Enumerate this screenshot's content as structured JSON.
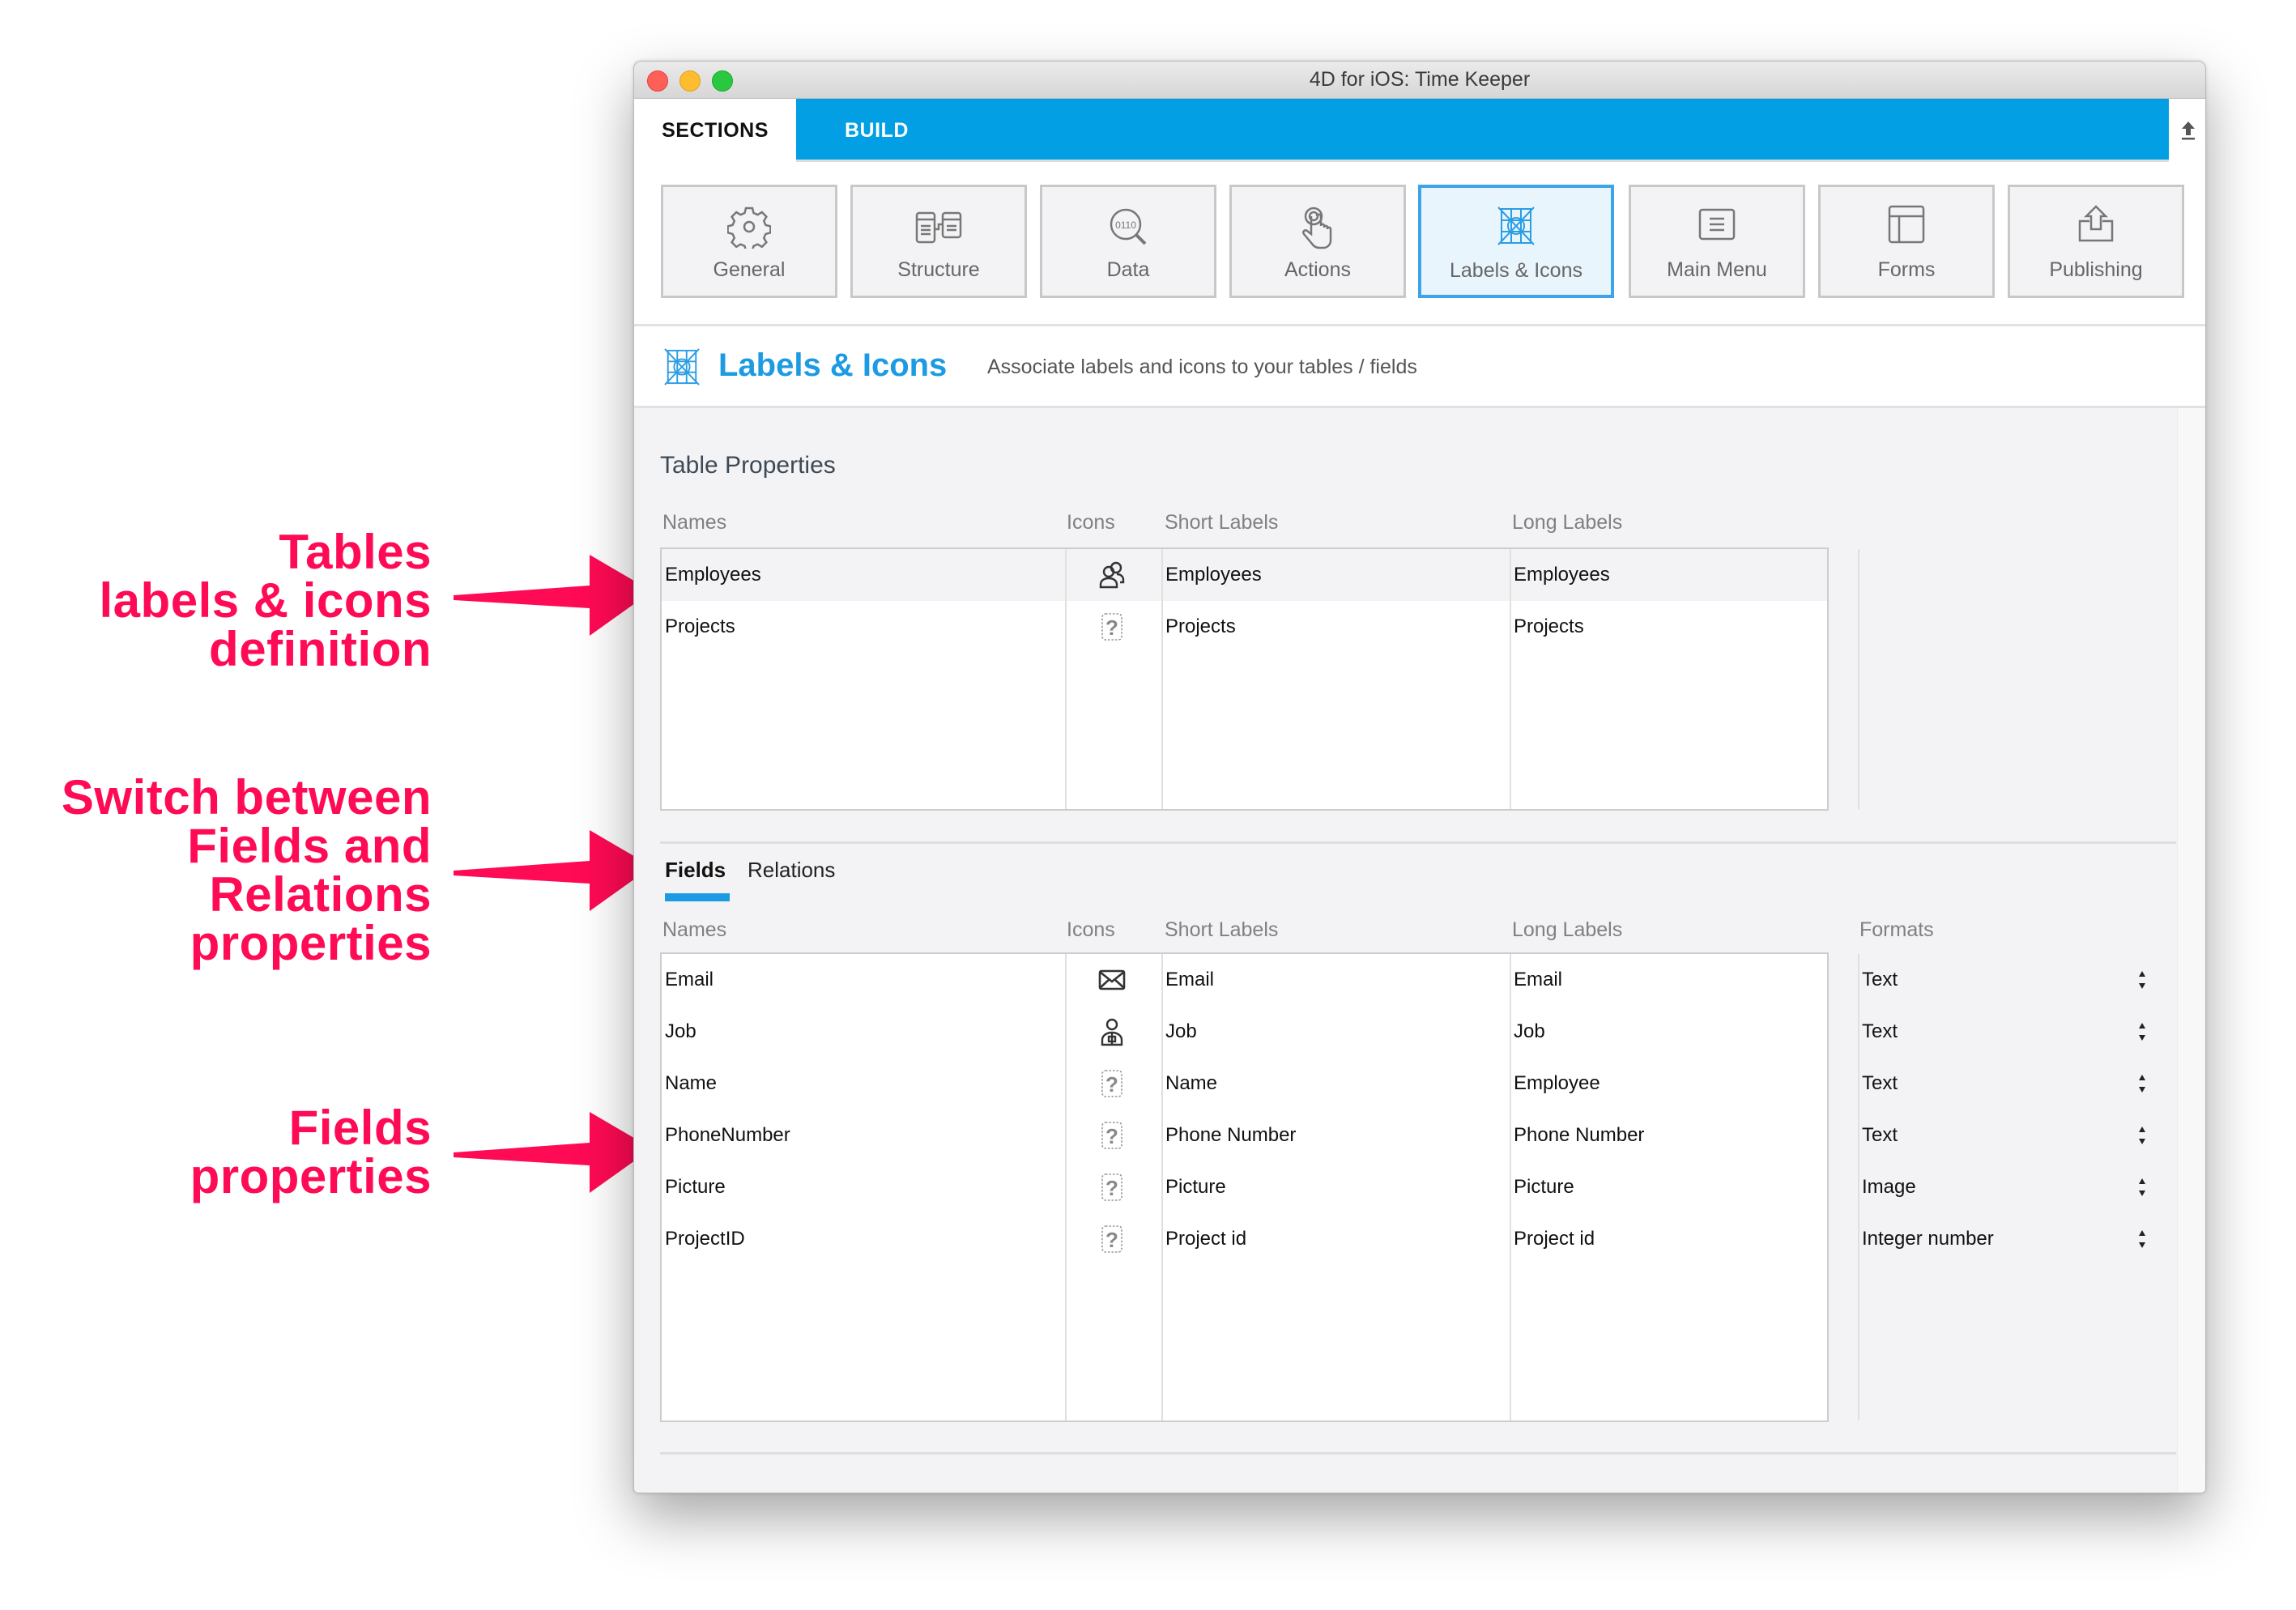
{
  "annotations": [
    {
      "lines": [
        "Tables",
        "labels & icons",
        "definition"
      ]
    },
    {
      "lines": [
        "Switch between",
        "Fields and",
        "Relations",
        "properties"
      ]
    },
    {
      "lines": [
        "Fields",
        "properties"
      ]
    }
  ],
  "window": {
    "title": "4D for iOS: Time Keeper"
  },
  "tabs": {
    "sections": "SECTIONS",
    "build": "BUILD",
    "upload_icon": "upload-icon"
  },
  "sections": [
    {
      "label": "General",
      "icon": "gear-icon",
      "active": false
    },
    {
      "label": "Structure",
      "icon": "structure-icon",
      "active": false
    },
    {
      "label": "Data",
      "icon": "data-search-icon",
      "active": false
    },
    {
      "label": "Actions",
      "icon": "touch-icon",
      "active": false
    },
    {
      "label": "Labels & Icons",
      "icon": "labels-icons-icon",
      "active": true
    },
    {
      "label": "Main Menu",
      "icon": "menu-icon",
      "active": false
    },
    {
      "label": "Forms",
      "icon": "forms-icon",
      "active": false
    },
    {
      "label": "Publishing",
      "icon": "publish-icon",
      "active": false
    }
  ],
  "header": {
    "title": "Labels & Icons",
    "subtitle": "Associate labels and icons to your tables / fields"
  },
  "table_properties": {
    "title": "Table Properties",
    "columns": [
      "Names",
      "Icons",
      "Short Labels",
      "Long Labels"
    ],
    "rows": [
      {
        "name": "Employees",
        "icon": "users-icon",
        "short_label": "Employees",
        "long_label": "Employees",
        "selected": true
      },
      {
        "name": "Projects",
        "icon": "unknown-icon",
        "short_label": "Projects",
        "long_label": "Projects",
        "selected": false
      }
    ]
  },
  "subtabs": {
    "fields": "Fields",
    "relations": "Relations",
    "active": "fields"
  },
  "fields": {
    "columns": [
      "Names",
      "Icons",
      "Short Labels",
      "Long Labels",
      "Formats"
    ],
    "rows": [
      {
        "name": "Email",
        "icon": "envelope-icon",
        "short_label": "Email",
        "long_label": "Email",
        "format": "Text"
      },
      {
        "name": "Job",
        "icon": "worker-icon",
        "short_label": "Job",
        "long_label": "Job",
        "format": "Text"
      },
      {
        "name": "Name",
        "icon": "unknown-icon",
        "short_label": "Name",
        "long_label": "Employee",
        "format": "Text"
      },
      {
        "name": "PhoneNumber",
        "icon": "unknown-icon",
        "short_label": "Phone Number",
        "long_label": "Phone Number",
        "format": "Text"
      },
      {
        "name": "Picture",
        "icon": "unknown-icon",
        "short_label": "Picture",
        "long_label": "Picture",
        "format": "Image"
      },
      {
        "name": "ProjectID",
        "icon": "unknown-icon",
        "short_label": "Project id",
        "long_label": "Project id",
        "format": "Integer number"
      }
    ]
  },
  "colors": {
    "accent": "#039fe4",
    "title_blue": "#1c9be2",
    "annotation": "#ff0a54"
  }
}
